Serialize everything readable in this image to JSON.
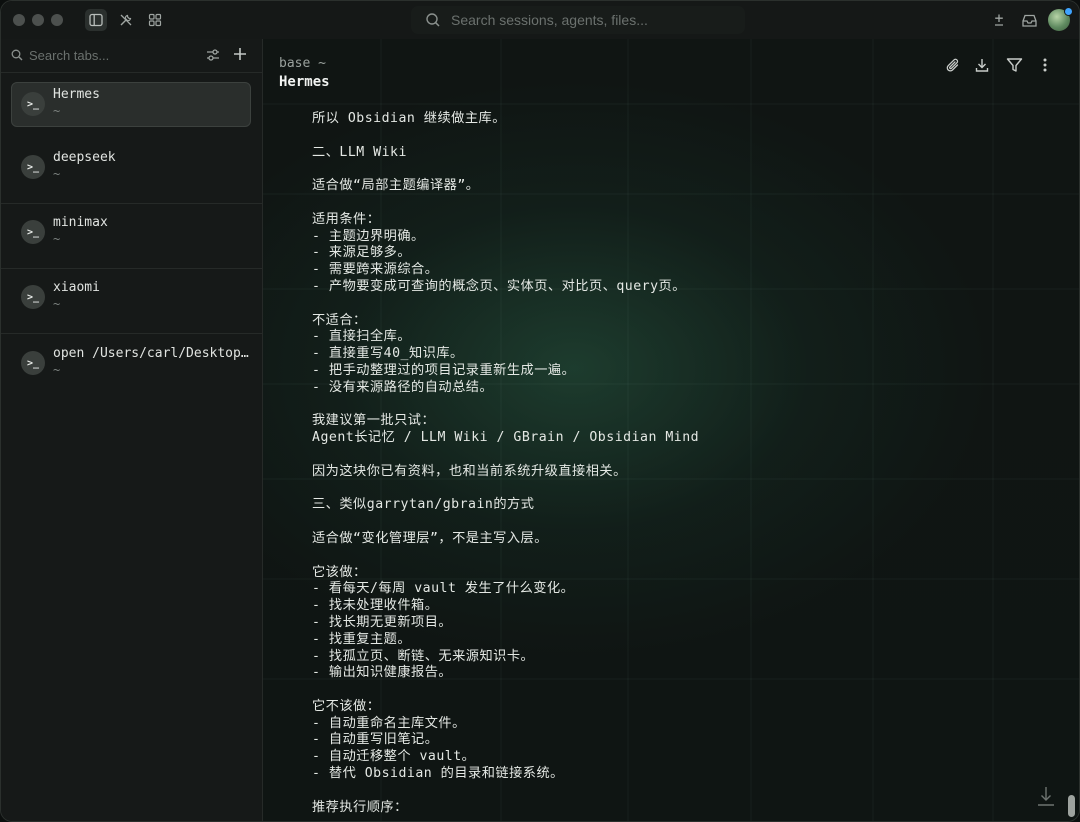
{
  "topbar": {
    "search_placeholder": "Search sessions, agents, files..."
  },
  "sidebar": {
    "search_placeholder": "Search tabs...",
    "tabs": [
      {
        "name": "Hermes",
        "sub": "~",
        "selected": true
      },
      {
        "name": "deepseek",
        "sub": "~",
        "selected": false
      },
      {
        "name": "minimax",
        "sub": "~",
        "selected": false
      },
      {
        "name": "xiaomi",
        "sub": "~",
        "selected": false
      },
      {
        "name": "open /Users/carl/Desktop…",
        "sub": "~",
        "selected": false
      }
    ],
    "tab_icon_glyph": ">_"
  },
  "main": {
    "breadcrumb": "base ~",
    "title": "Hermes",
    "lines": [
      "所以 Obsidian 继续做主库。",
      "",
      "二、LLM Wiki",
      "",
      "适合做“局部主题编译器”。",
      "",
      "适用条件：",
      "- 主题边界明确。",
      "- 来源足够多。",
      "- 需要跨来源综合。",
      "- 产物要变成可查询的概念页、实体页、对比页、query页。",
      "",
      "不适合：",
      "- 直接扫全库。",
      "- 直接重写40_知识库。",
      "- 把手动整理过的项目记录重新生成一遍。",
      "- 没有来源路径的自动总结。",
      "",
      "我建议第一批只试：",
      "Agent长记忆 / LLM Wiki / GBrain / Obsidian Mind",
      "",
      "因为这块你已有资料，也和当前系统升级直接相关。",
      "",
      "三、类似garrytan/gbrain的方式",
      "",
      "适合做“变化管理层”，不是主写入层。",
      "",
      "它该做：",
      "- 看每天/每周 vault 发生了什么变化。",
      "- 找未处理收件箱。",
      "- 找长期无更新项目。",
      "- 找重复主题。",
      "- 找孤立页、断链、无来源知识卡。",
      "- 输出知识健康报告。",
      "",
      "它不该做：",
      "- 自动重命名主库文件。",
      "- 自动重写旧笔记。",
      "- 自动迁移整个 vault。",
      "- 替代 Obsidian 的目录和链接系统。",
      "",
      "推荐执行顺序："
    ]
  },
  "colors": {
    "accent_badge": "#3fa4ff",
    "main_glow": "#2b5c44"
  },
  "icons": {
    "topbar": [
      "sidebar-toggle-icon",
      "tools-icon",
      "grid-icon",
      "search-icon",
      "plus-minus-icon",
      "inbox-icon"
    ],
    "header": [
      "paperclip-icon",
      "download-icon",
      "filter-icon",
      "more-vertical-icon"
    ]
  }
}
